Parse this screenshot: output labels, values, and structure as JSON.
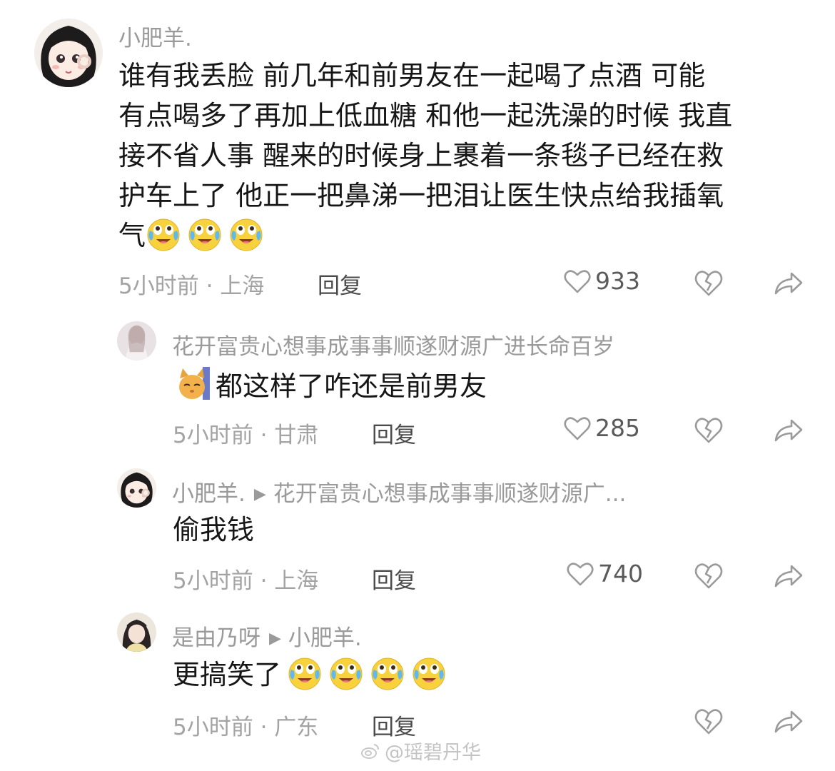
{
  "comments": [
    {
      "username": "小肥羊.",
      "text_lines": [
        "谁有我丢脸  前几年和前男友在一起喝了点酒  可能",
        "有点喝多了再加上低血糖  和他一起洗澡的时候  我直",
        "接不省人事  醒来的时候身上裹着一条毯子已经在救",
        "护车上了  他正一把鼻涕一把泪让医生快点给我插氧",
        "气"
      ],
      "emoji": "crying-laughing-face",
      "emoji_count": 3,
      "meta": "5小时前 · 上海",
      "reply_label": "回复",
      "likes": "933"
    },
    {
      "username": "花开富贵心想事成事事顺遂财源广进长命百岁",
      "text": "都这样了咋还是前男友",
      "leading_emoji": "cat-face-sticker",
      "meta": "5小时前 · 甘肃",
      "reply_label": "回复",
      "likes": "285"
    },
    {
      "username": "小肥羊.",
      "reply_to": "花开富贵心想事成事事顺遂财源广...",
      "text": "偷我钱",
      "meta": "5小时前 · 上海",
      "reply_label": "回复",
      "likes": "740"
    },
    {
      "username": "是由乃呀",
      "reply_to": "小肥羊.",
      "text": "更搞笑了",
      "emoji": "crying-laughing-face",
      "emoji_count": 4,
      "meta": "5小时前 · 广东",
      "reply_label": "回复"
    }
  ],
  "watermark": "@瑶碧丹华",
  "colors": {
    "meta_text": "#a3a3a3",
    "name_text": "#9a9a9a",
    "body_text": "#161616",
    "emoji_yellow": "#f7d23c"
  },
  "icons": [
    "heart-icon",
    "broken-heart-icon",
    "share-icon",
    "reply-arrow-icon",
    "weibo-icon"
  ]
}
